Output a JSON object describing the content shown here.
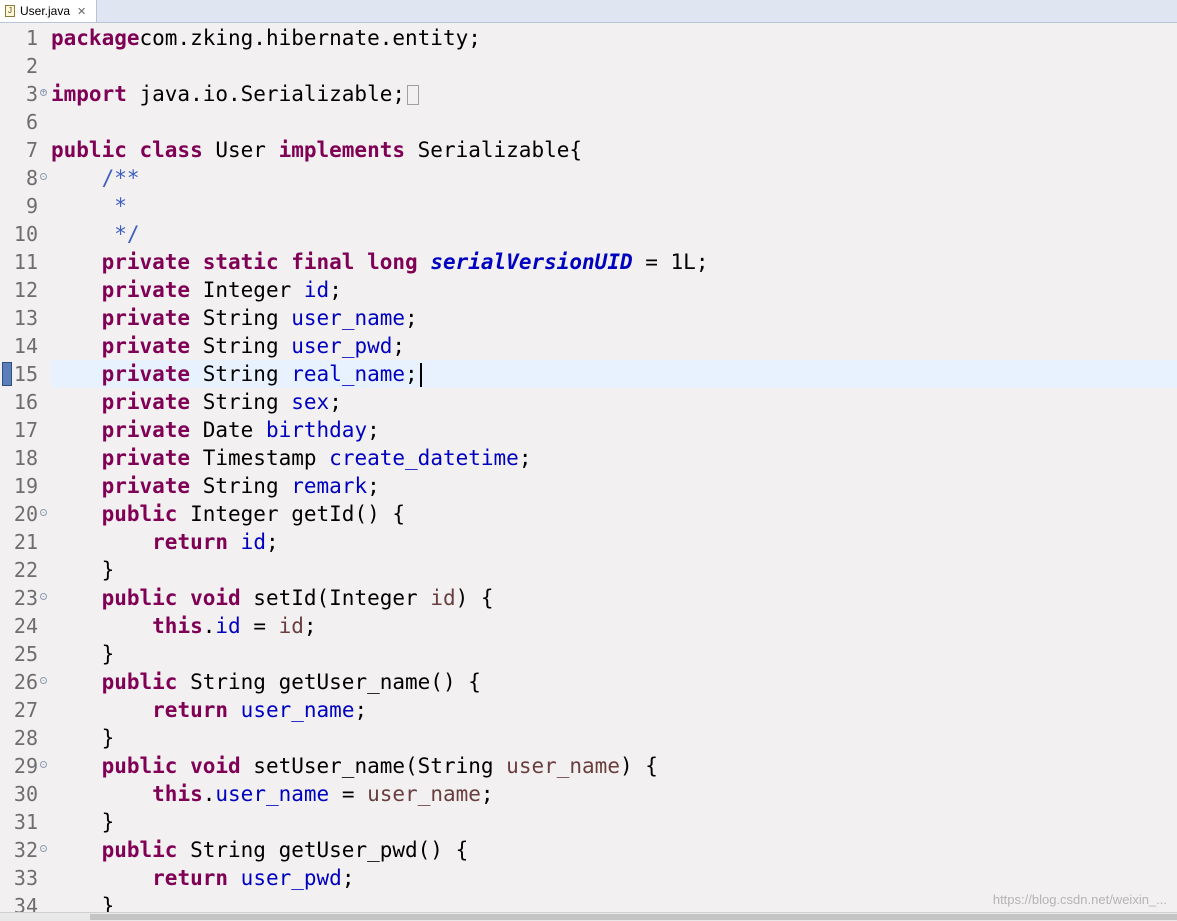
{
  "tab": {
    "title": "User.java",
    "icon": "java-file-icon",
    "close": "✕"
  },
  "editor": {
    "current_line": 15,
    "lines": [
      {
        "n": "1",
        "tokens": [
          [
            "kw",
            "package"
          ],
          [
            "",
            "com.zking.hibernate.entity;"
          ]
        ]
      },
      {
        "n": "2",
        "tokens": []
      },
      {
        "n": "3",
        "fold": "+",
        "tokens": [
          [
            "kw",
            "import"
          ],
          [
            "",
            " java.io.Serializable;"
          ],
          [
            "foldbox",
            ""
          ]
        ]
      },
      {
        "n": "6",
        "tokens": []
      },
      {
        "n": "7",
        "tokens": [
          [
            "kw",
            "public class"
          ],
          [
            "",
            " User "
          ],
          [
            "kw",
            "implements"
          ],
          [
            "",
            " Serializable{"
          ]
        ]
      },
      {
        "n": "8",
        "fold": "-",
        "tokens": [
          [
            "",
            "    "
          ],
          [
            "cmt",
            "/**"
          ]
        ]
      },
      {
        "n": "9",
        "tokens": [
          [
            "",
            "     "
          ],
          [
            "cmt",
            "*"
          ]
        ]
      },
      {
        "n": "10",
        "tokens": [
          [
            "",
            "     "
          ],
          [
            "cmt",
            "*/"
          ]
        ]
      },
      {
        "n": "11",
        "tokens": [
          [
            "",
            "    "
          ],
          [
            "kw",
            "private static final long"
          ],
          [
            "",
            " "
          ],
          [
            "sfld",
            "serialVersionUID"
          ],
          [
            "",
            " = 1L;"
          ]
        ]
      },
      {
        "n": "12",
        "tokens": [
          [
            "",
            "    "
          ],
          [
            "kw",
            "private"
          ],
          [
            "",
            " Integer "
          ],
          [
            "fld",
            "id"
          ],
          [
            "",
            ";"
          ]
        ]
      },
      {
        "n": "13",
        "tokens": [
          [
            "",
            "    "
          ],
          [
            "kw",
            "private"
          ],
          [
            "",
            " String "
          ],
          [
            "fld",
            "user_name"
          ],
          [
            "",
            ";"
          ]
        ]
      },
      {
        "n": "14",
        "tokens": [
          [
            "",
            "    "
          ],
          [
            "kw",
            "private"
          ],
          [
            "",
            " String "
          ],
          [
            "fld",
            "user_pwd"
          ],
          [
            "",
            ";"
          ]
        ]
      },
      {
        "n": "15",
        "tokens": [
          [
            "",
            "    "
          ],
          [
            "kw",
            "private"
          ],
          [
            "",
            " String "
          ],
          [
            "fld",
            "real_name"
          ],
          [
            "",
            ";"
          ],
          [
            "caret",
            ""
          ]
        ]
      },
      {
        "n": "16",
        "tokens": [
          [
            "",
            "    "
          ],
          [
            "kw",
            "private"
          ],
          [
            "",
            " String "
          ],
          [
            "fld",
            "sex"
          ],
          [
            "",
            ";"
          ]
        ]
      },
      {
        "n": "17",
        "tokens": [
          [
            "",
            "    "
          ],
          [
            "kw",
            "private"
          ],
          [
            "",
            " Date "
          ],
          [
            "fld",
            "birthday"
          ],
          [
            "",
            ";"
          ]
        ]
      },
      {
        "n": "18",
        "tokens": [
          [
            "",
            "    "
          ],
          [
            "kw",
            "private"
          ],
          [
            "",
            " Timestamp "
          ],
          [
            "fld",
            "create_datetime"
          ],
          [
            "",
            ";"
          ]
        ]
      },
      {
        "n": "19",
        "tokens": [
          [
            "",
            "    "
          ],
          [
            "kw",
            "private"
          ],
          [
            "",
            " String "
          ],
          [
            "fld",
            "remark"
          ],
          [
            "",
            ";"
          ]
        ]
      },
      {
        "n": "20",
        "fold": "-",
        "tokens": [
          [
            "",
            "    "
          ],
          [
            "kw",
            "public"
          ],
          [
            "",
            " Integer getId() {"
          ]
        ]
      },
      {
        "n": "21",
        "tokens": [
          [
            "",
            "        "
          ],
          [
            "kw",
            "return"
          ],
          [
            "",
            " "
          ],
          [
            "fld",
            "id"
          ],
          [
            "",
            ";"
          ]
        ]
      },
      {
        "n": "22",
        "tokens": [
          [
            "",
            "    }"
          ]
        ]
      },
      {
        "n": "23",
        "fold": "-",
        "tokens": [
          [
            "",
            "    "
          ],
          [
            "kw",
            "public void"
          ],
          [
            "",
            " setId(Integer "
          ],
          [
            "prm",
            "id"
          ],
          [
            "",
            ") {"
          ]
        ]
      },
      {
        "n": "24",
        "tokens": [
          [
            "",
            "        "
          ],
          [
            "kw",
            "this"
          ],
          [
            "",
            "."
          ],
          [
            "fld",
            "id"
          ],
          [
            "",
            " = "
          ],
          [
            "prm",
            "id"
          ],
          [
            "",
            ";"
          ]
        ]
      },
      {
        "n": "25",
        "tokens": [
          [
            "",
            "    }"
          ]
        ]
      },
      {
        "n": "26",
        "fold": "-",
        "tokens": [
          [
            "",
            "    "
          ],
          [
            "kw",
            "public"
          ],
          [
            "",
            " String getUser_name() {"
          ]
        ]
      },
      {
        "n": "27",
        "tokens": [
          [
            "",
            "        "
          ],
          [
            "kw",
            "return"
          ],
          [
            "",
            " "
          ],
          [
            "fld",
            "user_name"
          ],
          [
            "",
            ";"
          ]
        ]
      },
      {
        "n": "28",
        "tokens": [
          [
            "",
            "    }"
          ]
        ]
      },
      {
        "n": "29",
        "fold": "-",
        "tokens": [
          [
            "",
            "    "
          ],
          [
            "kw",
            "public void"
          ],
          [
            "",
            " setUser_name(String "
          ],
          [
            "prm",
            "user_name"
          ],
          [
            "",
            ") {"
          ]
        ]
      },
      {
        "n": "30",
        "tokens": [
          [
            "",
            "        "
          ],
          [
            "kw",
            "this"
          ],
          [
            "",
            "."
          ],
          [
            "fld",
            "user_name"
          ],
          [
            "",
            " = "
          ],
          [
            "prm",
            "user_name"
          ],
          [
            "",
            ";"
          ]
        ]
      },
      {
        "n": "31",
        "tokens": [
          [
            "",
            "    }"
          ]
        ]
      },
      {
        "n": "32",
        "fold": "-",
        "tokens": [
          [
            "",
            "    "
          ],
          [
            "kw",
            "public"
          ],
          [
            "",
            " String getUser_pwd() {"
          ]
        ]
      },
      {
        "n": "33",
        "tokens": [
          [
            "",
            "        "
          ],
          [
            "kw",
            "return"
          ],
          [
            "",
            " "
          ],
          [
            "fld",
            "user_pwd"
          ],
          [
            "",
            ";"
          ]
        ]
      },
      {
        "n": "34",
        "tokens": [
          [
            "",
            "    }"
          ]
        ]
      }
    ]
  },
  "watermark": "https://blog.csdn.net/weixin_...",
  "colors": {
    "keyword": "#7f0055",
    "field": "#0000c0",
    "comment": "#3f5fbf",
    "param": "#6a3e3e",
    "current_line": "#e8f2fe"
  }
}
